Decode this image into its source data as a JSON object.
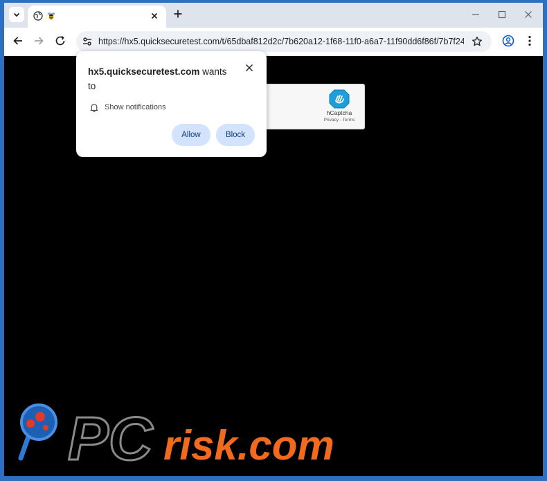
{
  "browser": {
    "tab": {
      "title": ""
    },
    "url": "https://hx5.quicksecuretest.com/t/65dbaf812d2c/7b620a12-1f68-11f0-a6a7-11f90dd6f86f/7b7f24..."
  },
  "popup": {
    "domain": "hx5.quicksecuretest.com",
    "wants_text": " wants to",
    "permission": "Show notifications",
    "allow_label": "Allow",
    "block_label": "Block"
  },
  "captcha": {
    "brand": "hCaptcha",
    "privacy": "Privacy",
    "separator": " - ",
    "terms": "Terms"
  },
  "watermark": {
    "text_pc": "PC",
    "text_site": "risk.com"
  },
  "icons": {
    "tab_search": "chevron-down-icon",
    "tab_globe": "globe-icon",
    "tab_favicon": "bee-icon",
    "tab_close": "close-icon",
    "new_tab": "plus-icon",
    "minimize": "minimize-icon",
    "maximize": "maximize-icon",
    "close_window": "close-icon",
    "back": "back-arrow-icon",
    "forward": "forward-arrow-icon",
    "reload": "reload-icon",
    "site_info": "tune-icon",
    "bookmark": "star-icon",
    "profile": "profile-icon",
    "menu": "kebab-menu-icon",
    "bell": "bell-icon"
  },
  "colors": {
    "frame": "#2e6fc0",
    "tabstrip": "#dfe3eb",
    "omnibox": "#eef1f6",
    "button_bg": "#d3e3fd",
    "button_text": "#0b3a8c",
    "page_bg": "#000000",
    "watermark_orange": "#f26a1b",
    "watermark_gray": "#8a8a8a"
  }
}
